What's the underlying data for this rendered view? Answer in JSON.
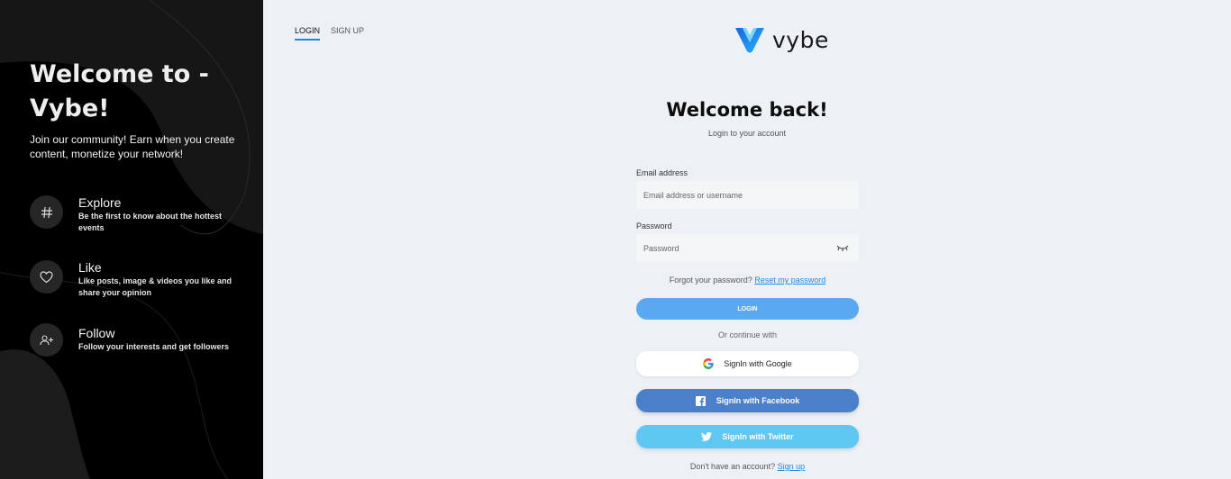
{
  "left_panel": {
    "title": "Welcome to - Vybe!",
    "subtitle": "Join our community! Earn when you create content, monetize your network!",
    "features": [
      {
        "title": "Explore",
        "description": "Be the first to know about the hottest events",
        "icon": "hashtag-icon"
      },
      {
        "title": "Like",
        "description": "Like posts, image & videos you like and share your opinion",
        "icon": "heart-icon"
      },
      {
        "title": "Follow",
        "description": "Follow your interests and get followers",
        "icon": "add-user-icon"
      }
    ]
  },
  "tabs": {
    "login": "LOGIN",
    "signup": "SIGN UP",
    "active": "login"
  },
  "logo": {
    "text": "vybe",
    "icon": "vybe-logo-icon"
  },
  "form": {
    "heading": "Welcome back!",
    "subheading": "Login to your account",
    "email_label": "Email address",
    "email_placeholder": "Email address or username",
    "password_label": "Password",
    "password_placeholder": "Password",
    "forgot_text": "Forgot your password?",
    "reset_link": "Reset my password",
    "login_button": "LOGIN",
    "continue_text": "Or continue with",
    "google_button": "SignIn with Google",
    "facebook_button": "SignIn with Facebook",
    "twitter_button": "SignIn with Twitter",
    "no_account_text": "Don't have an account?",
    "signup_link": "Sign up"
  },
  "colors": {
    "accent": "#1e88e5",
    "login_button": "#5aa8f0",
    "facebook": "#4a7fc9",
    "twitter": "#5fc8f2",
    "page_bg": "#edf1f6",
    "left_bg": "#000000"
  }
}
